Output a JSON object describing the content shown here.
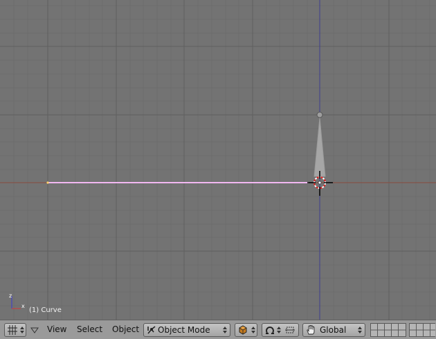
{
  "viewport": {
    "object_info": "(1) Curve",
    "axis_labels": {
      "x": "x",
      "z": "z"
    }
  },
  "header": {
    "menus": {
      "view": "View",
      "select": "Select",
      "object": "Object"
    },
    "mode_selector": {
      "selected": "Object Mode"
    },
    "transform_orientation": {
      "selected": "Global"
    }
  },
  "icons": {
    "editor_type": "grid-icon",
    "menu_collapse": "triangle-down-icon",
    "mode": "object-mode-icon",
    "draw_type": "solid-draw-icon",
    "pivot": "pivot-icon",
    "proportional": "proportional-edit-icon",
    "manipulator": "hand-icon",
    "layers": "layer-grid-icon"
  },
  "colors": {
    "viewport_bg": "#737373",
    "grid_line": "#636363",
    "x_axis": "#8a4b3e",
    "y_axis": "#3f3f8c",
    "curve": "#f2b8f2",
    "header_bg": "#9a9a9a"
  }
}
